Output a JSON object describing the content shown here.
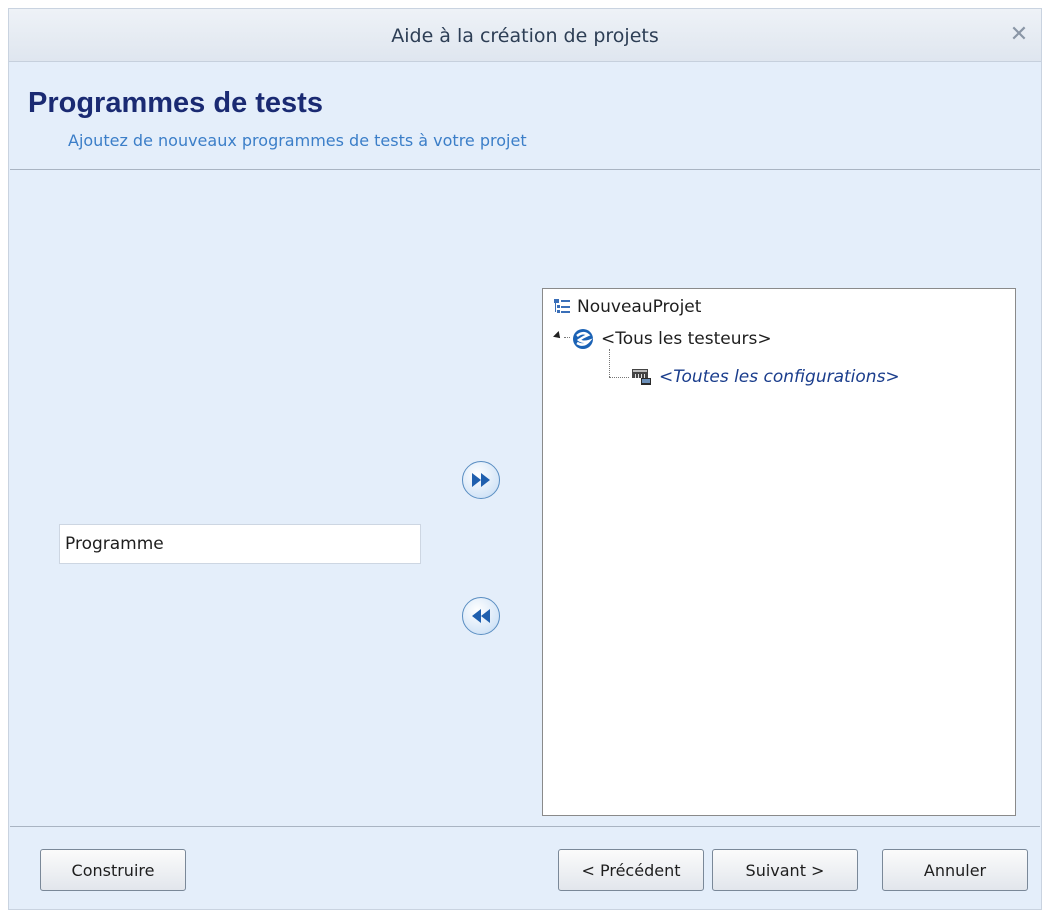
{
  "window": {
    "title": "Aide à la création de projets"
  },
  "header": {
    "title": "Programmes de tests",
    "subtitle": "Ajoutez de nouveaux programmes de tests à votre projet"
  },
  "left": {
    "program_value": "Programme"
  },
  "tree": {
    "root": "NouveauProjet",
    "child": "<Tous les testeurs>",
    "grandchild": "<Toutes les configurations>"
  },
  "footer": {
    "build": "Construire",
    "previous": "< Précédent",
    "next": "Suivant >",
    "cancel": "Annuler"
  },
  "icons": {
    "close": "close-icon",
    "add": "fast-forward-icon",
    "remove": "rewind-icon",
    "root": "project-tree-icon",
    "tester": "tester-globe-icon",
    "config": "configuration-icon"
  },
  "colors": {
    "accent": "#1a2a72",
    "subtitle": "#3b7ec8",
    "background": "#e4eefa"
  }
}
